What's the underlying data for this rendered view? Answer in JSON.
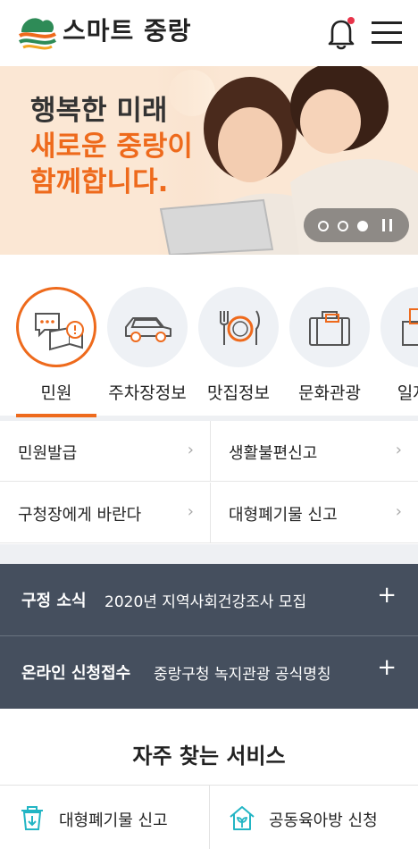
{
  "header": {
    "title": "스마트 중랑",
    "logo_icon": "jungnang-logo-icon",
    "notification_icon": "bell-icon",
    "menu_icon": "hamburger-menu-icon",
    "notification_dot_color": "#e8344a"
  },
  "banner": {
    "line1": "행복한 미래",
    "line2": "새로운 중랑이",
    "line3": "함께합니다.",
    "slide_index": 3,
    "slide_count": 3
  },
  "categories": [
    {
      "label": "민원",
      "icon": "civil-complaint-icon",
      "active": true
    },
    {
      "label": "주차장정보",
      "icon": "car-icon",
      "active": false
    },
    {
      "label": "맛집정보",
      "icon": "restaurant-icon",
      "active": false
    },
    {
      "label": "문화관광",
      "icon": "suitcase-icon",
      "active": false
    },
    {
      "label": "일자리",
      "icon": "job-icon",
      "active": false
    }
  ],
  "links": [
    {
      "label": "민원발급"
    },
    {
      "label": "생활불편신고"
    },
    {
      "label": "구청장에게 바란다"
    },
    {
      "label": "대형폐기물 신고"
    }
  ],
  "news": [
    {
      "title": "구정 소식",
      "desc": "2020년 지역사회건강조사 모집"
    },
    {
      "title": "온라인 신청접수",
      "desc": "중랑구청 녹지관광 공식명칭"
    }
  ],
  "services": {
    "title": "자주 찾는 서비스",
    "items": [
      {
        "label": "대형폐기물 신고",
        "icon": "waste-bin-icon"
      },
      {
        "label": "공동육아방 신청",
        "icon": "house-sprout-icon"
      }
    ]
  },
  "colors": {
    "accent": "#ee6a1c",
    "news_bg": "#454f5e",
    "banner_bg": "#fbe7d4",
    "service_icon": "#22b5c4"
  }
}
